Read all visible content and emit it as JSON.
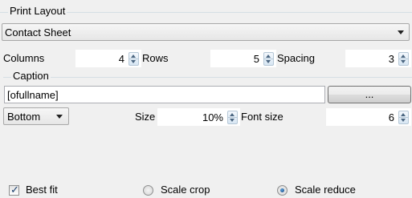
{
  "print_layout": {
    "group_title": "Print Layout",
    "layout_value": "Contact Sheet"
  },
  "grid": {
    "columns_label": "Columns",
    "columns_value": "4",
    "rows_label": "Rows",
    "rows_value": "5",
    "spacing_label": "Spacing",
    "spacing_value": "3"
  },
  "caption": {
    "group_title": "Caption",
    "text_value": "[ofullname]",
    "browse_label": "...",
    "position_value": "Bottom",
    "size_label": "Size",
    "size_value": "10%",
    "font_size_label": "Font size",
    "font_size_value": "6"
  },
  "scaling": {
    "best_fit_label": "Best fit",
    "best_fit_checked": true,
    "scale_crop_label": "Scale crop",
    "scale_reduce_label": "Scale reduce",
    "selected": "Scale reduce"
  }
}
